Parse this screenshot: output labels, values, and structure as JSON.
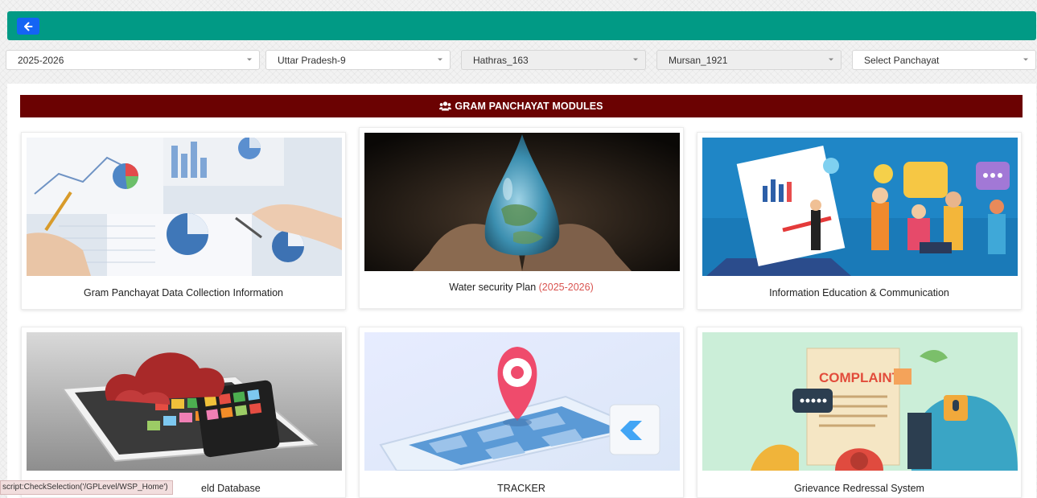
{
  "filters": {
    "year": "2025-2026",
    "state": "Uttar Pradesh-9",
    "district": "Hathras_163",
    "block": "Mursan_1921",
    "panchayat_placeholder": "Select Panchayat"
  },
  "modules": {
    "header": "GRAM PANCHAYAT MODULES",
    "cards": [
      {
        "title": "Gram Panchayat Data Collection Information"
      },
      {
        "title": "Water security Plan",
        "accent": "(2025-2026)"
      },
      {
        "title": "Information Education & Communication"
      },
      {
        "title": "eld Database"
      },
      {
        "title": "TRACKER"
      },
      {
        "title": "Grievance Redressal System"
      }
    ]
  },
  "illustrations": {
    "complaint_text": "COMPLAINT"
  },
  "statusbar": "script:CheckSelection('/GPLevel/WSP_Home')",
  "colors": {
    "topbar": "#019a85",
    "back_button": "#1464f4",
    "modules_header": "#6b0202",
    "accent_text": "#d9534f"
  },
  "icons": {
    "back": "arrow-left-icon",
    "dropdown": "caret-down-icon",
    "header": "users-icon"
  }
}
